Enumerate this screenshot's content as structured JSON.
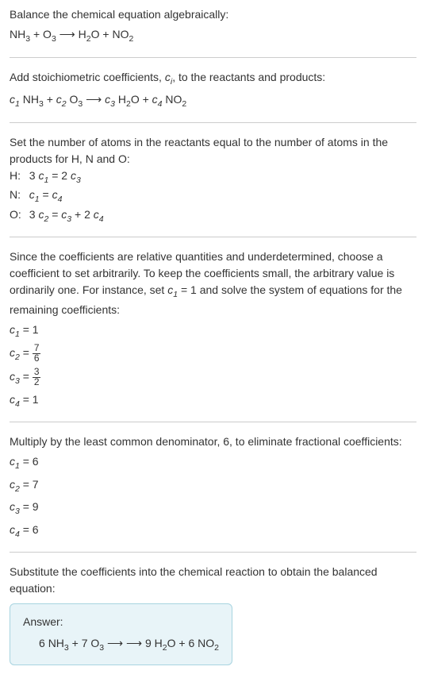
{
  "intro": "Balance the chemical equation algebraically:",
  "eq_unbalanced_lhs1": "NH",
  "eq_unbalanced_lhs1_sub": "3",
  "eq_unbalanced_plus1": " + ",
  "eq_unbalanced_lhs2": "O",
  "eq_unbalanced_lhs2_sub": "3",
  "eq_unbalanced_arrow": " ⟶ ",
  "eq_unbalanced_rhs1": "H",
  "eq_unbalanced_rhs1_sub": "2",
  "eq_unbalanced_rhs1b": "O",
  "eq_unbalanced_plus2": " + ",
  "eq_unbalanced_rhs2": "NO",
  "eq_unbalanced_rhs2_sub": "2",
  "stoich_intro": "Add stoichiometric coefficients, ",
  "stoich_ci": "c",
  "stoich_ci_sub": "i",
  "stoich_intro2": ", to the reactants and products:",
  "c1": "c",
  "c1_sub": "1",
  "c2": "c",
  "c2_sub": "2",
  "c3": "c",
  "c3_sub": "3",
  "c4": "c",
  "c4_sub": "4",
  "atoms_intro": "Set the number of atoms in the reactants equal to the number of atoms in the products for H, N and O:",
  "atom_H_label": "H:",
  "atom_H_eq_pre": "3 ",
  "atom_H_eq_mid": " = 2 ",
  "atom_N_label": "N:",
  "atom_N_eq_mid": " = ",
  "atom_O_label": "O:",
  "atom_O_eq_pre": "3 ",
  "atom_O_eq_mid": " = ",
  "atom_O_eq_plus": " + 2 ",
  "underdet_text": "Since the coefficients are relative quantities and underdetermined, choose a coefficient to set arbitrarily. To keep the coefficients small, the arbitrary value is ordinarily one. For instance, set ",
  "underdet_set": " = 1",
  "underdet_text2": " and solve the system of equations for the remaining coefficients:",
  "sol_c1": " = 1",
  "sol_c2": " = ",
  "sol_c2_num": "7",
  "sol_c2_den": "6",
  "sol_c3": " = ",
  "sol_c3_num": "3",
  "sol_c3_den": "2",
  "sol_c4": " = 1",
  "mult_text": "Multiply by the least common denominator, 6, to eliminate fractional coefficients:",
  "mult_c1": " = 6",
  "mult_c2": " = 7",
  "mult_c3": " = 9",
  "mult_c4": " = 6",
  "subst_text": "Substitute the coefficients into the chemical reaction to obtain the balanced equation:",
  "answer_label": "Answer:",
  "final_coef1": "6 ",
  "final_coef2": " + 7 ",
  "final_coef3": " ⟶ 9 ",
  "final_coef4": " + 6 "
}
